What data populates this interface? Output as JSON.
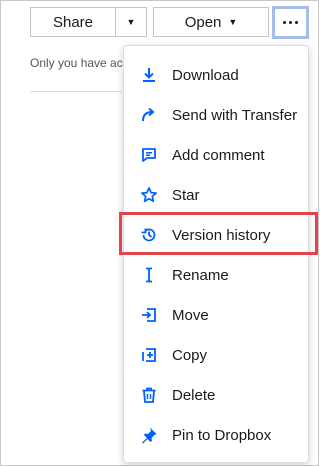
{
  "toolbar": {
    "share_label": "Share",
    "open_label": "Open"
  },
  "note": {
    "text": "Only you have ac"
  },
  "menu": {
    "items": [
      {
        "label": "Download",
        "icon": "download-icon"
      },
      {
        "label": "Send with Transfer",
        "icon": "send-arrow-icon"
      },
      {
        "label": "Add comment",
        "icon": "comment-icon"
      },
      {
        "label": "Star",
        "icon": "star-icon"
      },
      {
        "label": "Version history",
        "icon": "history-icon"
      },
      {
        "label": "Rename",
        "icon": "text-cursor-icon"
      },
      {
        "label": "Move",
        "icon": "move-icon"
      },
      {
        "label": "Copy",
        "icon": "copy-icon"
      },
      {
        "label": "Delete",
        "icon": "trash-icon"
      },
      {
        "label": "Pin to Dropbox",
        "icon": "pin-icon"
      }
    ],
    "highlighted_item": "Version history"
  },
  "colors": {
    "icon_blue": "#0061fe",
    "highlight_red": "#e2444b",
    "more_button_focus": "#a7bde9"
  }
}
